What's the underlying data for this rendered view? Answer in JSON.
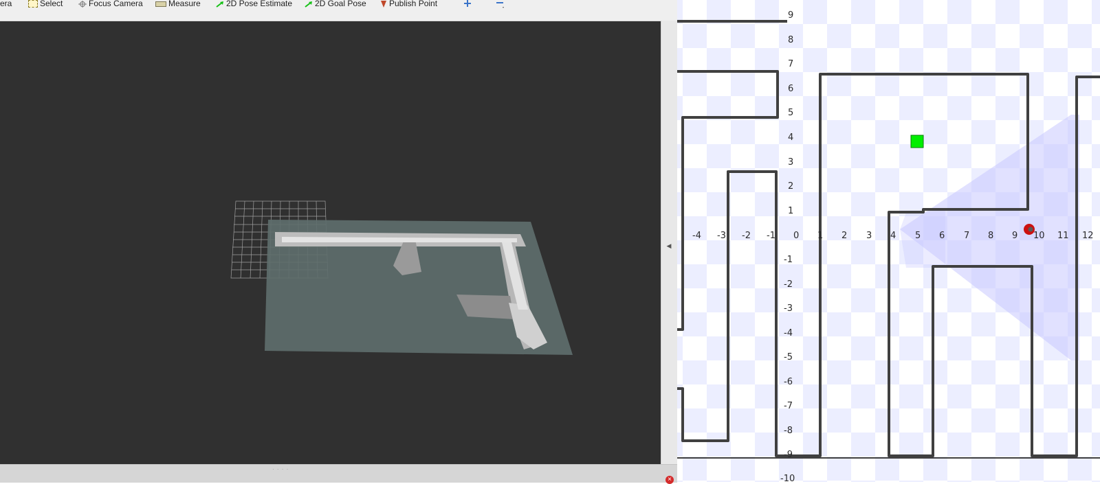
{
  "toolbar": {
    "items": [
      {
        "label": "era",
        "icon": "none"
      },
      {
        "label": "Select",
        "icon": "select-icon"
      },
      {
        "label": "Focus Camera",
        "icon": "focus-camera-icon"
      },
      {
        "label": "Measure",
        "icon": "measure-icon"
      },
      {
        "label": "2D Pose Estimate",
        "icon": "green-arrow-icon"
      },
      {
        "label": "2D Goal Pose",
        "icon": "green-arrow-icon"
      },
      {
        "label": "Publish Point",
        "icon": "pin-icon"
      }
    ],
    "add_tool_icon": "plus-icon",
    "remove_tool_icon": "minus-icon"
  },
  "viewport": {
    "background": "#303030",
    "map_plane_color": "#5e6e6c",
    "grid_color": "#9a9a9a"
  },
  "map": {
    "x_ticks": [
      "-4",
      "-3",
      "-2",
      "-1",
      "0",
      "1",
      "2",
      "3",
      "4",
      "5",
      "6",
      "7",
      "8",
      "9",
      "10",
      "11",
      "12"
    ],
    "y_ticks": [
      "9",
      "8",
      "7",
      "6",
      "5",
      "4",
      "3",
      "2",
      "1",
      "0",
      "-1",
      "-2",
      "-3",
      "-4",
      "-5",
      "-6",
      "-7",
      "-8",
      "-9",
      "-10"
    ],
    "wall_color": "#404040",
    "goal_marker_color": "#00ee00",
    "robot_marker_color": "#cc1111",
    "laser_fan_color": "#c8c8ff"
  }
}
